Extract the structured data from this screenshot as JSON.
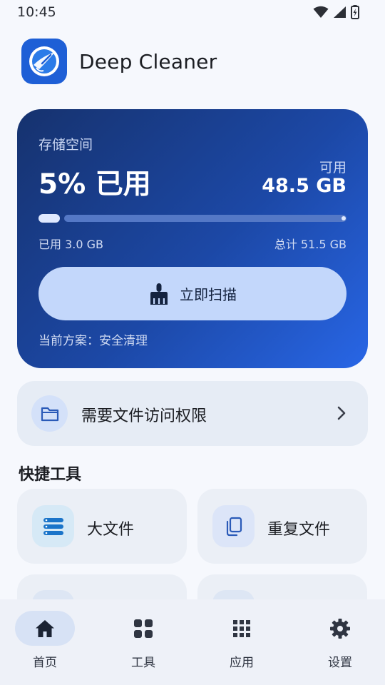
{
  "status_bar": {
    "time": "10:45"
  },
  "app": {
    "title": "Deep Cleaner"
  },
  "storage": {
    "label": "存储空间",
    "used_percent_text": "5% 已用",
    "used_fraction": 0.05,
    "available_label": "可用",
    "available_value": "48.5 GB",
    "used_text": "已用 3.0 GB",
    "total_text": "总计 51.5 GB",
    "scan_button_label": "立即扫描",
    "plan_text": "当前方案：安全清理"
  },
  "permission": {
    "label": "需要文件访问权限"
  },
  "quick_tools": {
    "title": "快捷工具",
    "items": [
      {
        "label": "大文件",
        "icon": "stack-list-icon",
        "icon_bg": "#d6e9f6",
        "icon_color": "#1a74c9"
      },
      {
        "label": "重复文件",
        "icon": "copy-icon",
        "icon_bg": "#dce5f8",
        "icon_color": "#2a5ab8"
      }
    ]
  },
  "nav": {
    "items": [
      {
        "label": "首页",
        "icon": "home-icon",
        "active": true
      },
      {
        "label": "工具",
        "icon": "tools-grid-icon",
        "active": false
      },
      {
        "label": "应用",
        "icon": "apps-grid-icon",
        "active": false
      },
      {
        "label": "设置",
        "icon": "gear-icon",
        "active": false
      }
    ]
  },
  "colors": {
    "accent": "#2866e6",
    "card_gradient_start": "#16326e",
    "card_gradient_end": "#2866e6",
    "scan_button": "#c3d7fb"
  }
}
